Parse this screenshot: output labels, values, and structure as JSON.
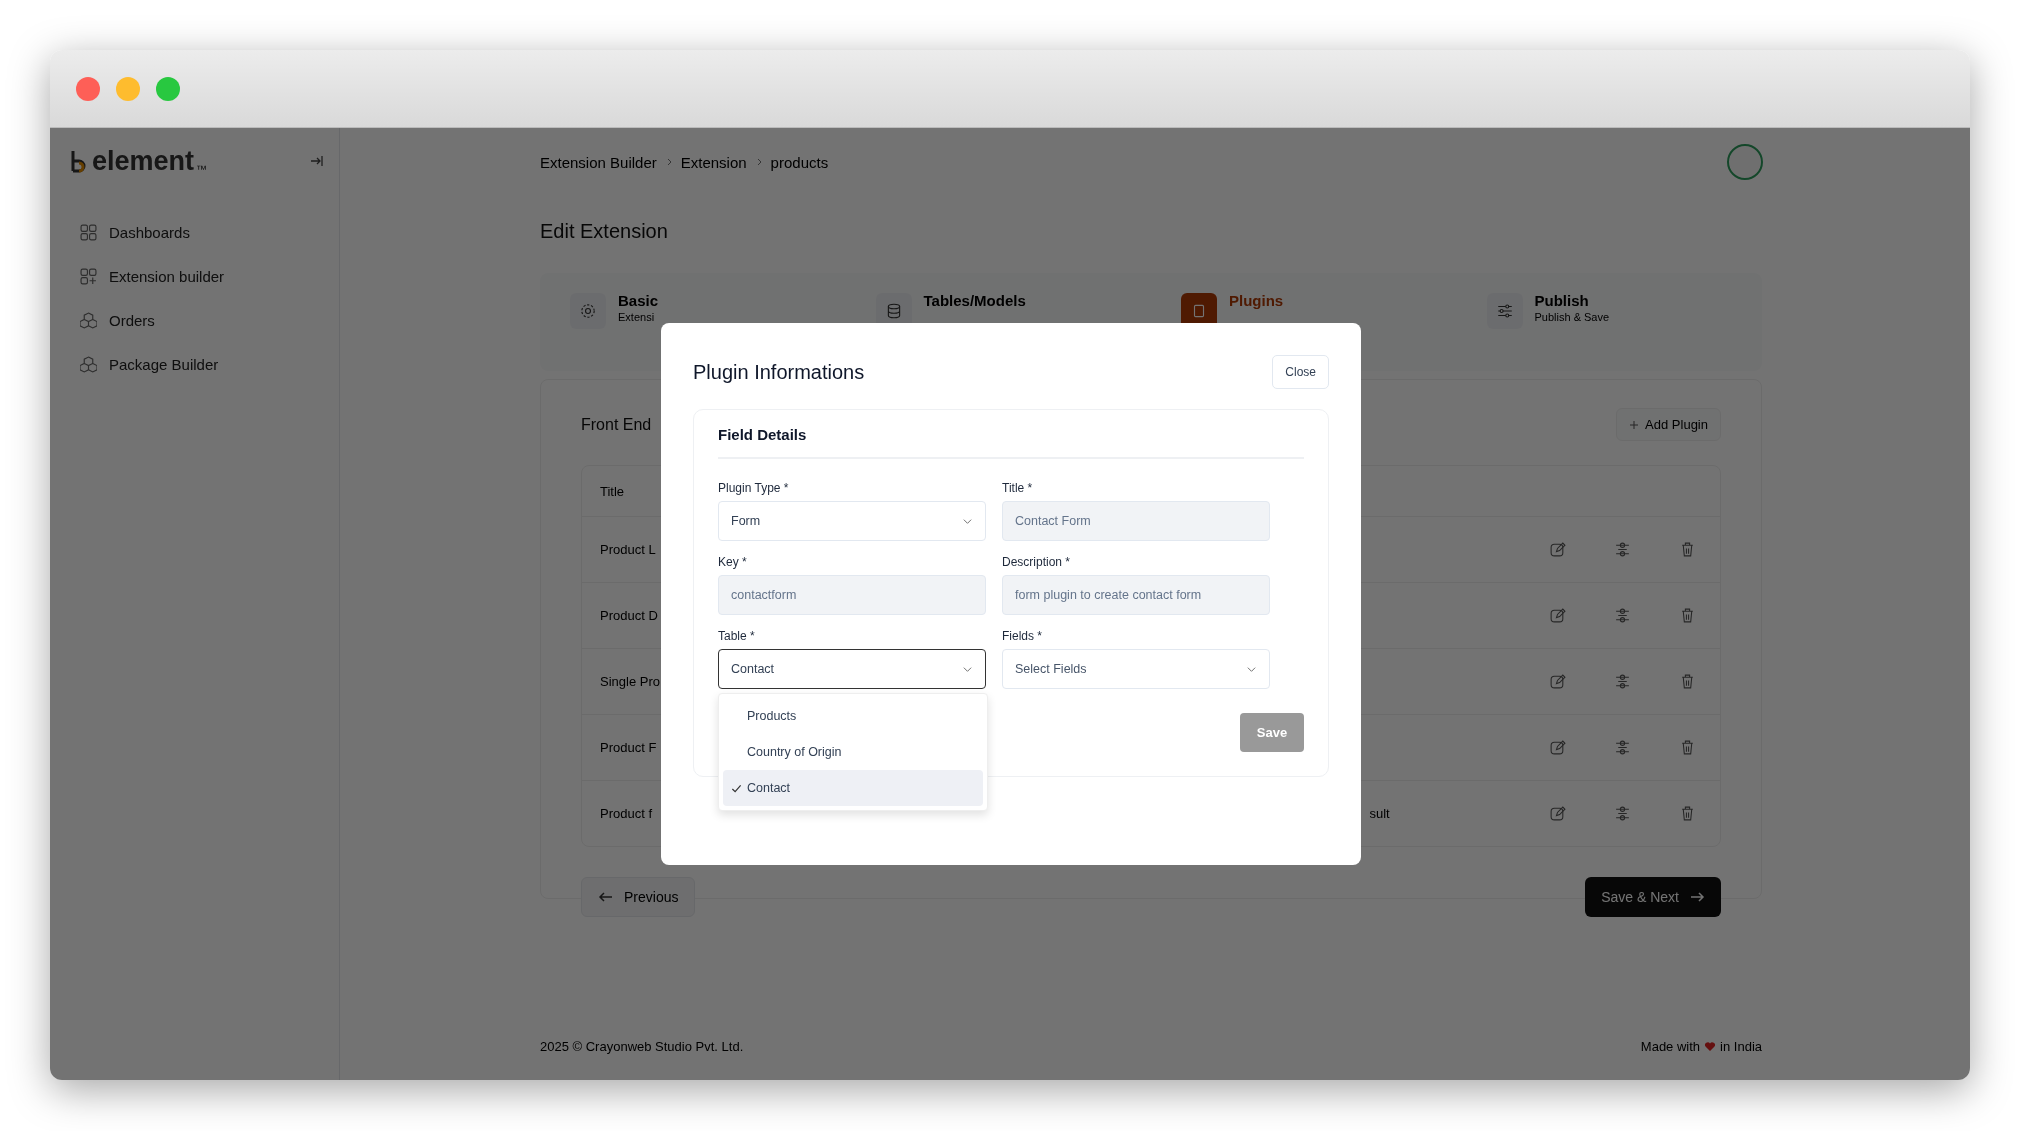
{
  "logo": {
    "text": "element",
    "mark": "™"
  },
  "sidebar": {
    "items": [
      {
        "label": "Dashboards"
      },
      {
        "label": "Extension builder"
      },
      {
        "label": "Orders"
      },
      {
        "label": "Package Builder"
      }
    ]
  },
  "breadcrumb": [
    "Extension Builder",
    "Extension",
    "products"
  ],
  "page_title": "Edit Extension",
  "steps": [
    {
      "title": "Basic",
      "subtitle": "Extensi",
      "selected": false
    },
    {
      "title": "Tables/Models",
      "selected": false
    },
    {
      "title": "Plugins",
      "selected": true
    },
    {
      "title": "Publish",
      "subtitle": "Publish & Save",
      "selected": false
    }
  ],
  "section": {
    "title": "Front End",
    "add_button": "Add Plugin"
  },
  "table": {
    "columns": [
      "Title"
    ],
    "rows": [
      {
        "title": "Product L"
      },
      {
        "title": "Product D"
      },
      {
        "title": "Single Pro"
      },
      {
        "title": "Product F"
      },
      {
        "title": "Product f",
        "column_2": "sult"
      }
    ]
  },
  "nav_buttons": {
    "previous": "Previous",
    "next": "Save & Next"
  },
  "footer": {
    "copyright": "2025 ©  Crayonweb Studio Pvt. Ltd.",
    "made_with": "Made with",
    "in": "in India"
  },
  "modal": {
    "title": "Plugin Informations",
    "close": "Close",
    "card_title": "Field Details",
    "fields": [
      {
        "kind": "select",
        "label": "Plugin Type *",
        "value": "Form",
        "disabled": false,
        "focused": false
      },
      {
        "kind": "input",
        "label": "Title *",
        "value": "Contact Form",
        "disabled": true,
        "focused": false
      },
      {
        "kind": "input",
        "label": "Key *",
        "value": "contactform",
        "disabled": true,
        "focused": false
      },
      {
        "kind": "input",
        "label": "Description *",
        "value": "form plugin to create contact form",
        "disabled": true,
        "focused": false
      },
      {
        "kind": "select",
        "label": "Table *",
        "value": "Contact",
        "disabled": false,
        "focused": true,
        "options": [
          {
            "label": "Products",
            "selected": false
          },
          {
            "label": "Country of Origin",
            "selected": false
          },
          {
            "label": "Contact",
            "selected": true
          }
        ]
      },
      {
        "kind": "select",
        "label": "Fields *",
        "placeholder": "Select Fields",
        "disabled": false,
        "focused": false
      }
    ],
    "save": {
      "label": "Save",
      "disabled": true
    }
  }
}
